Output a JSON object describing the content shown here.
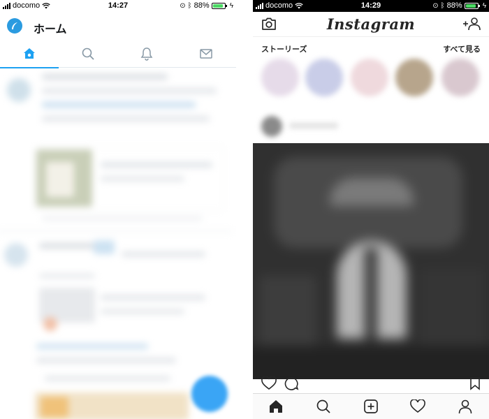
{
  "twitter": {
    "status": {
      "carrier": "docomo",
      "time": "14:27",
      "battery": "88%"
    },
    "header": {
      "title": "ホーム",
      "logo_icon": "feather-logo-icon"
    },
    "tabs": [
      {
        "name": "home",
        "icon": "home-icon",
        "active": true
      },
      {
        "name": "search",
        "icon": "search-icon",
        "active": false
      },
      {
        "name": "notifications",
        "icon": "bell-icon",
        "active": false
      },
      {
        "name": "messages",
        "icon": "envelope-icon",
        "active": false
      }
    ],
    "accent": "#1da1f2",
    "fab_color": "#3aa5f5"
  },
  "instagram": {
    "status": {
      "carrier": "docomo",
      "time": "14:29",
      "battery": "88%"
    },
    "header": {
      "logo": "Instagram"
    },
    "stories": {
      "label": "ストーリーズ",
      "see_all": "すべて見る"
    },
    "tabbar": [
      "home-icon",
      "search-icon",
      "new-post-icon",
      "heart-icon",
      "profile-icon"
    ],
    "battery_color": "#4cd964"
  }
}
